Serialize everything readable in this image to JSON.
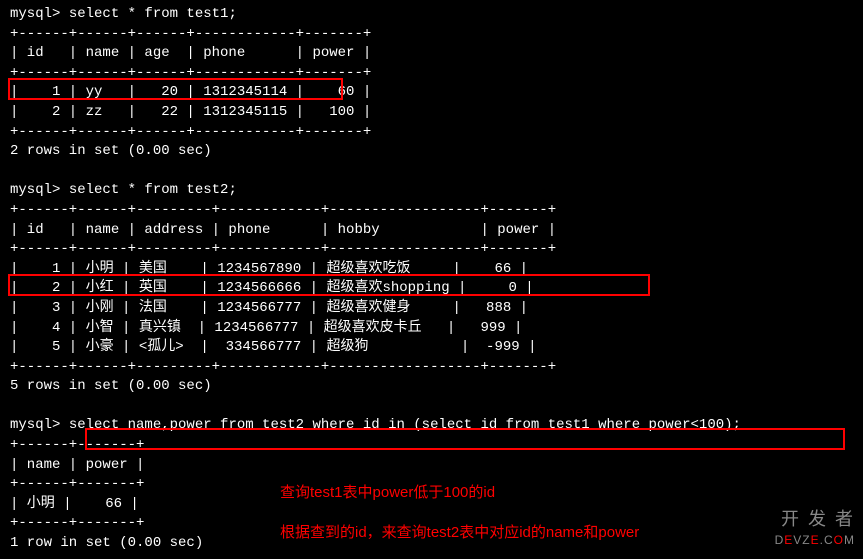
{
  "query1": {
    "prompt": "mysql> ",
    "sql": "select * from test1;",
    "divider": "+------+------+------+------------+-------+",
    "header": "| id   | name | age  | phone      | power |",
    "rows": [
      "|    1 | yy   |   20 | 1312345114 |    60 |",
      "|    2 | zz   |   22 | 1312345115 |   100 |"
    ],
    "footer": "2 rows in set (0.00 sec)"
  },
  "query2": {
    "prompt": "mysql> ",
    "sql": "select * from test2;",
    "divider": "+------+------+---------+------------+------------------+-------+",
    "header": "| id   | name | address | phone      | hobby            | power |",
    "rows": [
      "|    1 | 小明 | 美国    | 1234567890 | 超级喜欢吃饭     |    66 |",
      "|    2 | 小红 | 英国    | 1234566666 | 超级喜欢shopping |     0 |",
      "|    3 | 小刚 | 法国    | 1234566777 | 超级喜欢健身     |   888 |",
      "|    4 | 小智 | 真兴镇  | 1234566777 | 超级喜欢皮卡丘   |   999 |",
      "|    5 | 小豪 | <孤儿>  |  334566777 | 超级狗           |  -999 |"
    ],
    "footer": "5 rows in set (0.00 sec)"
  },
  "query3": {
    "prompt": "mysql> ",
    "sql": "select name,power from test2 where id in (select id from test1 where power<100);",
    "divider": "+------+-------+",
    "header": "| name | power |",
    "rows": [
      "| 小明 |    66 |"
    ],
    "footer": "1 row in set (0.00 sec)"
  },
  "annotations": {
    "line1": "查询test1表中power低于100的id",
    "line2": "根据查到的id，来查询test2表中对应id的name和power"
  },
  "watermark": {
    "cn": "开 发 者",
    "en": "DEVZE.COM"
  }
}
